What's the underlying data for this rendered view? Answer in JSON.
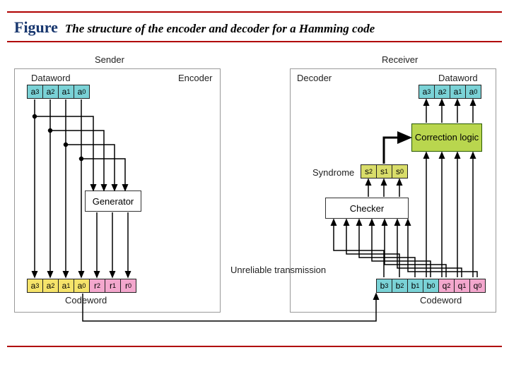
{
  "figure_label": "Figure",
  "figure_title": "The structure of the encoder and decoder for a Hamming code",
  "sender": {
    "title": "Sender",
    "encoder_label": "Encoder",
    "dataword_label": "Dataword",
    "codeword_label": "Codeword",
    "generator_label": "Generator",
    "dataword_cells": [
      "a3",
      "a2",
      "a1",
      "a0"
    ],
    "codeword_cells": [
      "a3",
      "a2",
      "a1",
      "a0",
      "r2",
      "r1",
      "r0"
    ]
  },
  "receiver": {
    "title": "Receiver",
    "decoder_label": "Decoder",
    "dataword_label": "Dataword",
    "codeword_label": "Codeword",
    "correction_label": "Correction logic",
    "syndrome_label": "Syndrome",
    "checker_label": "Checker",
    "syndrome_cells": [
      "s2",
      "s1",
      "s0"
    ],
    "dataword_cells": [
      "a3",
      "a2",
      "a1",
      "a0"
    ],
    "codeword_cells": [
      "b3",
      "b2",
      "b1",
      "b0",
      "q2",
      "q1",
      "q0"
    ]
  },
  "transmission_label": "Unreliable transmission"
}
